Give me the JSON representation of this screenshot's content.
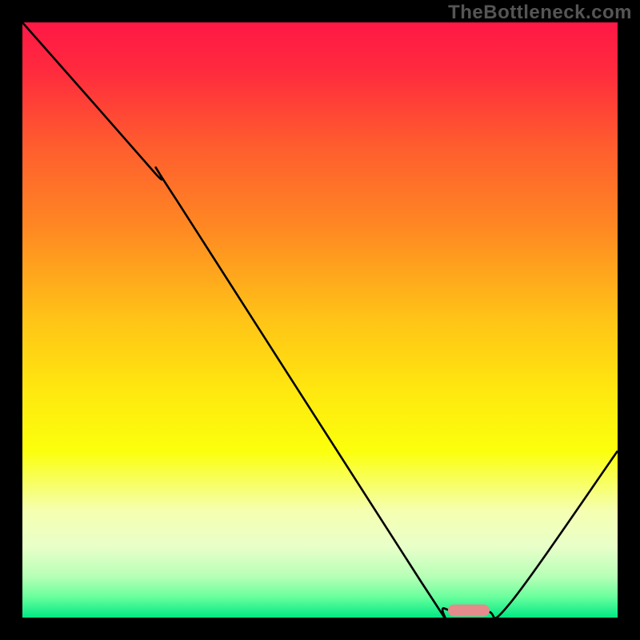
{
  "watermark": "TheBottleneck.com",
  "chart_data": {
    "type": "line",
    "title": "",
    "xlabel": "",
    "ylabel": "",
    "xlim": [
      0,
      100
    ],
    "ylim": [
      0,
      100
    ],
    "grid": false,
    "legend": false,
    "gradient_bg": {
      "stops": [
        {
          "offset": 0.0,
          "color": "#ff1846"
        },
        {
          "offset": 0.08,
          "color": "#ff2a3e"
        },
        {
          "offset": 0.2,
          "color": "#ff5a2f"
        },
        {
          "offset": 0.35,
          "color": "#ff8a22"
        },
        {
          "offset": 0.5,
          "color": "#ffc417"
        },
        {
          "offset": 0.62,
          "color": "#ffe80f"
        },
        {
          "offset": 0.72,
          "color": "#fbff0c"
        },
        {
          "offset": 0.82,
          "color": "#f5ffb0"
        },
        {
          "offset": 0.88,
          "color": "#e9ffc9"
        },
        {
          "offset": 0.93,
          "color": "#b8ffb8"
        },
        {
          "offset": 0.965,
          "color": "#6bff9e"
        },
        {
          "offset": 1.0,
          "color": "#00e884"
        }
      ]
    },
    "series": [
      {
        "name": "bottleneck-curve",
        "points": [
          {
            "x": 0,
            "y": 100
          },
          {
            "x": 22,
            "y": 75
          },
          {
            "x": 26,
            "y": 70
          },
          {
            "x": 67,
            "y": 6
          },
          {
            "x": 71,
            "y": 1.5
          },
          {
            "x": 78,
            "y": 1.0
          },
          {
            "x": 82,
            "y": 2.5
          },
          {
            "x": 100,
            "y": 28
          }
        ]
      }
    ],
    "marker": {
      "name": "optimal-range",
      "x_center": 75,
      "y": 1.2,
      "width": 7,
      "color": "#e58b8b"
    }
  }
}
